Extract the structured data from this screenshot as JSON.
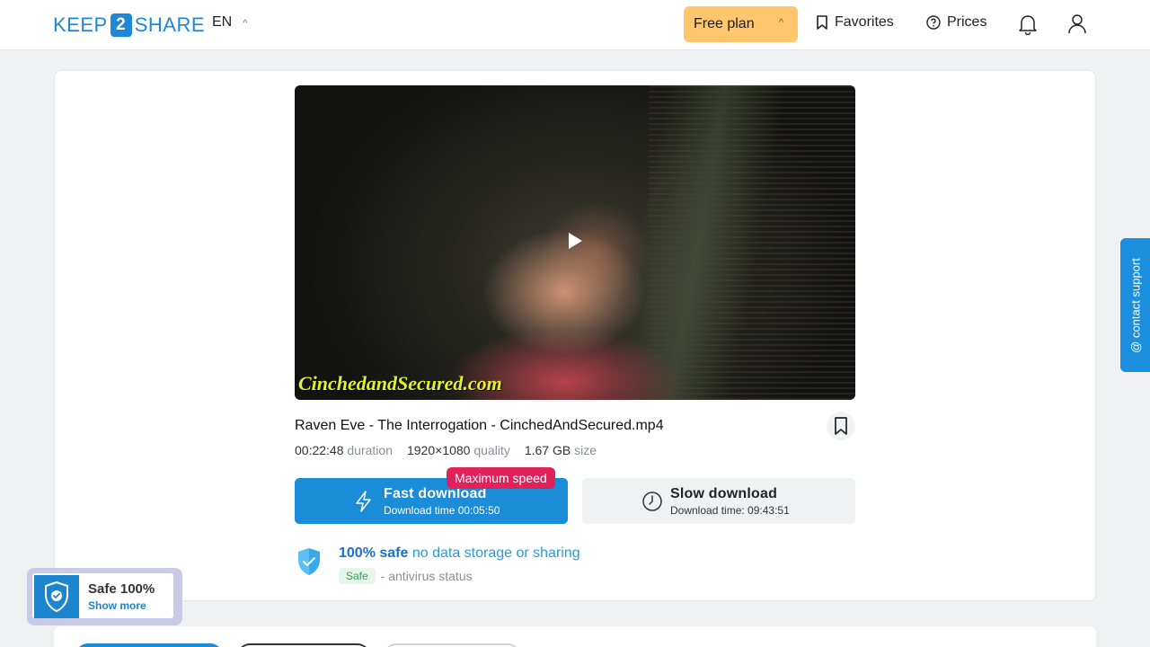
{
  "header": {
    "logo": {
      "left": "KEEP",
      "mid": "2",
      "right": "SHARE"
    },
    "language": "EN",
    "free_plan": "Free plan",
    "favorites": "Favorites",
    "prices": "Prices"
  },
  "file": {
    "watermark": "CinchedandSecured.com",
    "title": "Raven Eve - The Interrogation - CinchedAndSecured.mp4",
    "duration": "00:22:48",
    "duration_label": "duration",
    "quality": "1920×1080",
    "quality_label": "quality",
    "size": "1.67 GB",
    "size_label": "size"
  },
  "downloads": {
    "fast_label": "Fast download",
    "fast_time": "Download time 00:05:50",
    "speed_badge": "Maximum speed",
    "slow_label": "Slow download",
    "slow_time": "Download time: 09:43:51"
  },
  "safety": {
    "bold": "100% safe",
    "normal": "no data storage or sharing",
    "pill": "Safe",
    "status": "- antivirus status"
  },
  "contact_support": "@ contact support",
  "safe_popup": {
    "title": "Safe 100%",
    "link": "Show more"
  },
  "colors": {
    "accent": "#1b8cd8",
    "plan": "#ffc66b",
    "badge": "#e0225a"
  }
}
